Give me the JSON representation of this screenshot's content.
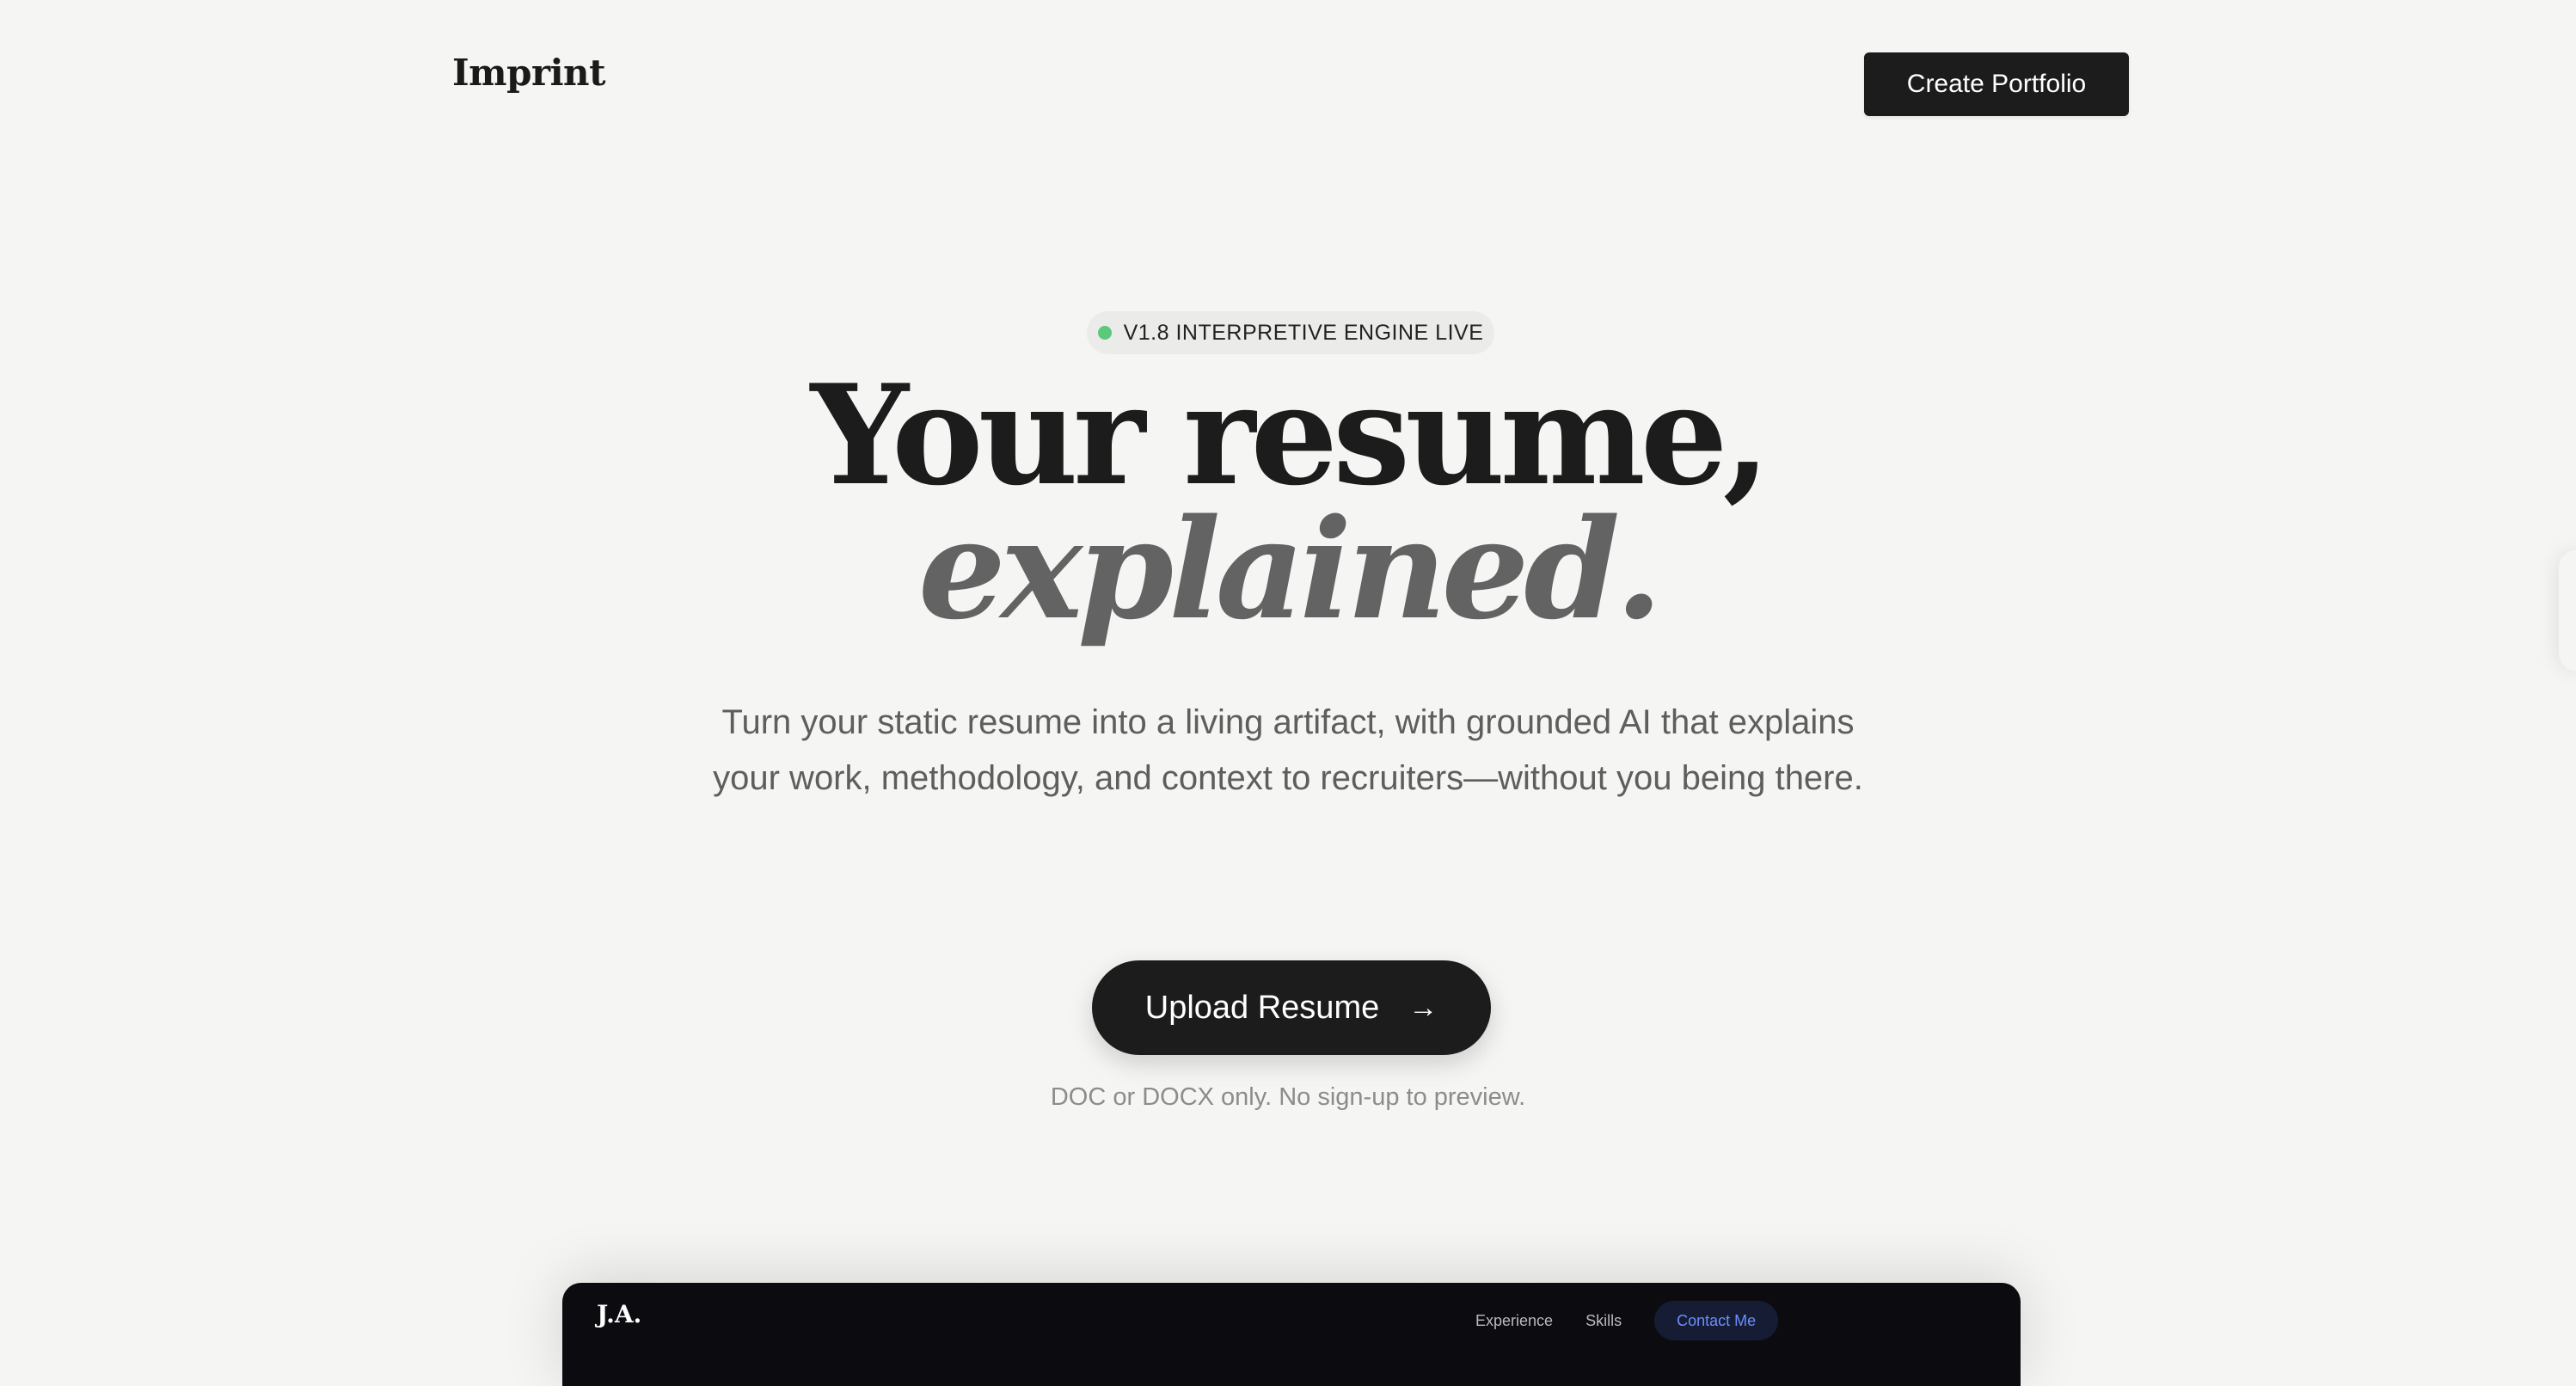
{
  "header": {
    "brand": "Imprint",
    "cta_label": "Create Portfolio"
  },
  "hero": {
    "badge_text": "V1.8 INTERPRETIVE ENGINE LIVE",
    "badge_status_color": "#5cc97a",
    "headline_line1": "Your resume,",
    "headline_line2": "explained.",
    "subtitle": "Turn your static resume into a living artifact, with grounded AI that explains your work, methodology, and context to recruiters—without you being there.",
    "upload_label": "Upload Resume",
    "upload_icon": "arrow-right-icon",
    "upload_note": "DOC or DOCX only. No sign-up to preview."
  },
  "preview": {
    "logo": "J.A.",
    "nav_items": [
      "Experience",
      "Skills"
    ],
    "contact_label": "Contact Me"
  },
  "colors": {
    "background": "#f5f5f3",
    "primary_dark": "#1c1c1c",
    "preview_bg": "#0c0c10",
    "accent_blue": "#6e8dff"
  }
}
